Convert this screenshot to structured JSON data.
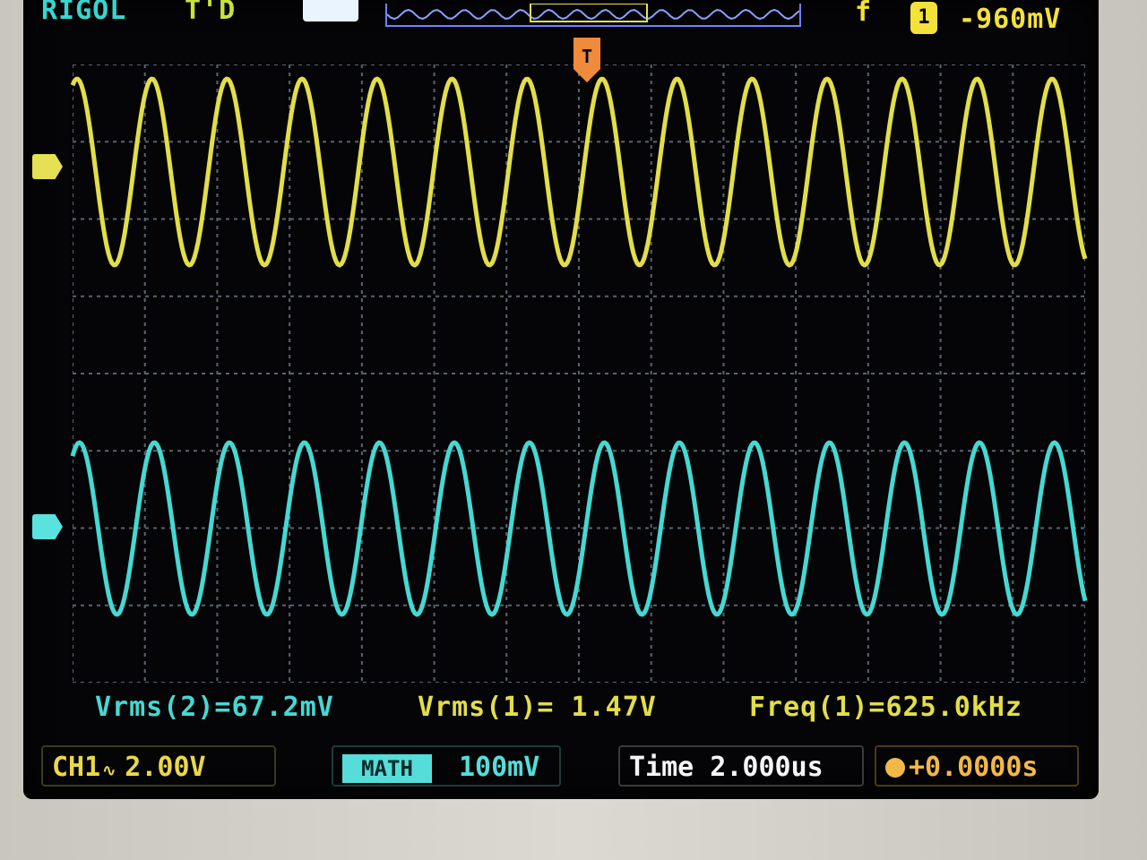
{
  "header": {
    "brand": "RIGOL",
    "trigger_status": "T'D",
    "trigger_slope": "f",
    "trigger_source": "1",
    "trigger_level": "-960mV"
  },
  "measurements": {
    "vrms2": "Vrms(2)=67.2mV",
    "vrms1": "Vrms(1)= 1.47V",
    "freq1": "Freq(1)=625.0kHz"
  },
  "channels": {
    "ch1_label": "CH1",
    "ch1_coupling": "∿",
    "ch1_scale": "2.00V",
    "ch2_tag": "MATH",
    "ch2_scale": "100mV"
  },
  "timebase": {
    "time": "Time 2.000us",
    "offset": "+0.0000s"
  },
  "markers": {
    "ch1": "1",
    "ch2": "2",
    "trigger_position": "T"
  },
  "colors": {
    "ch1": "#e2de49",
    "ch2": "#46d8d2",
    "trigger": "#f08a3c",
    "grid": "#5a6470"
  },
  "waveforms": {
    "ch1_cycles_on_screen": 13.5,
    "ch2_cycles_on_screen": 13.5
  }
}
